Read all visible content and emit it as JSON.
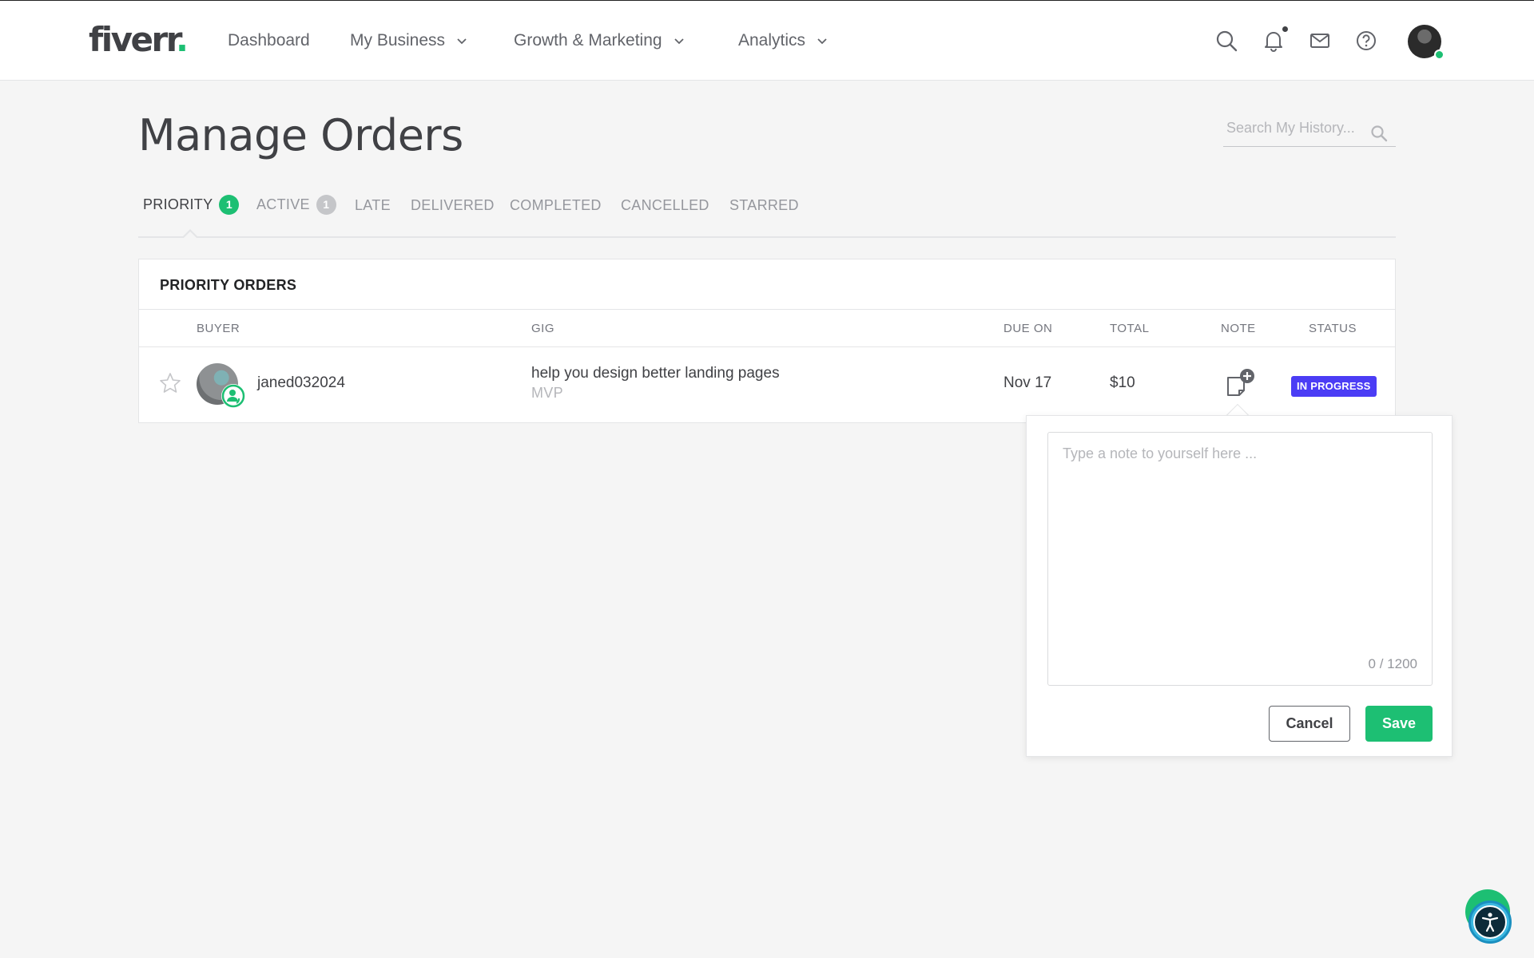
{
  "header": {
    "logo_text": "fiverr",
    "logo_dot": ".",
    "nav": [
      {
        "label": "Dashboard"
      },
      {
        "label": "My Business"
      },
      {
        "label": "Growth & Marketing"
      },
      {
        "label": "Analytics"
      }
    ],
    "icons": [
      "search-icon",
      "bell-icon",
      "mail-icon",
      "help-icon"
    ]
  },
  "page": {
    "title": "Manage Orders",
    "search_placeholder": "Search My History..."
  },
  "tabs": [
    {
      "label": "PRIORITY",
      "count": "1",
      "active": true
    },
    {
      "label": "ACTIVE",
      "count": "1"
    },
    {
      "label": "LATE"
    },
    {
      "label": "DELIVERED"
    },
    {
      "label": "COMPLETED"
    },
    {
      "label": "CANCELLED"
    },
    {
      "label": "STARRED"
    }
  ],
  "table": {
    "title": "PRIORITY ORDERS",
    "columns": {
      "buyer": "BUYER",
      "gig": "GIG",
      "due_on": "DUE ON",
      "total": "TOTAL",
      "note": "NOTE",
      "status": "STATUS"
    },
    "rows": [
      {
        "buyer": "janed032024",
        "gig_title": "help you design better landing pages",
        "gig_package": "MVP",
        "due_on": "Nov 17",
        "total": "$10",
        "status": "IN PROGRESS"
      }
    ]
  },
  "note_popover": {
    "placeholder": "Type a note to yourself here ...",
    "counter": "0 / 1200",
    "cancel_label": "Cancel",
    "save_label": "Save"
  },
  "colors": {
    "brand_green": "#1dbf73",
    "status_purple": "#4b3df5",
    "text_dark": "#404145"
  }
}
